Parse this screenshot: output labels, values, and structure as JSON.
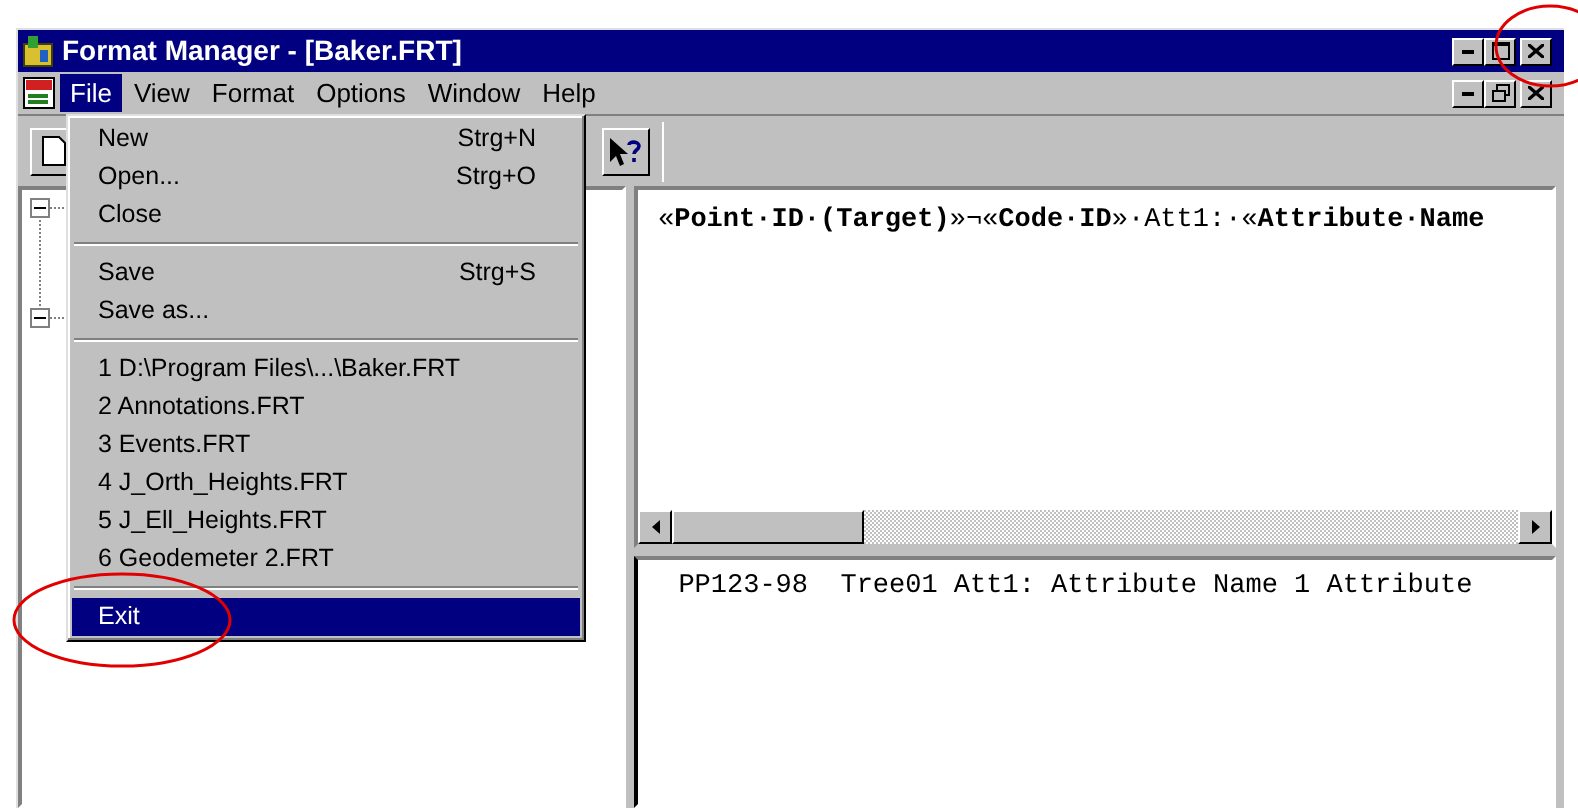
{
  "window": {
    "title": "Format Manager - [Baker.FRT]"
  },
  "menu_bar": [
    {
      "label": "File",
      "selected": true
    },
    {
      "label": "View",
      "selected": false
    },
    {
      "label": "Format",
      "selected": false
    },
    {
      "label": "Options",
      "selected": false
    },
    {
      "label": "Window",
      "selected": false
    },
    {
      "label": "Help",
      "selected": false
    }
  ],
  "file_menu": [
    {
      "kind": "item",
      "label": "New",
      "shortcut": "Strg+N",
      "selected": false
    },
    {
      "kind": "item",
      "label": "Open...",
      "shortcut": "Strg+O",
      "selected": false
    },
    {
      "kind": "item",
      "label": "Close",
      "selected": false
    },
    {
      "kind": "separator"
    },
    {
      "kind": "item",
      "label": "Save",
      "shortcut": "Strg+S",
      "selected": false
    },
    {
      "kind": "item",
      "label": "Save as...",
      "selected": false
    },
    {
      "kind": "separator"
    },
    {
      "kind": "item",
      "label": "1 D:\\Program Files\\...\\Baker.FRT",
      "selected": false
    },
    {
      "kind": "item",
      "label": "2 Annotations.FRT",
      "selected": false
    },
    {
      "kind": "item",
      "label": "3 Events.FRT",
      "selected": false
    },
    {
      "kind": "item",
      "label": "4 J_Orth_Heights.FRT",
      "selected": false
    },
    {
      "kind": "item",
      "label": "5 J_Ell_Heights.FRT",
      "selected": false
    },
    {
      "kind": "item",
      "label": "6 Geodemeter 2.FRT",
      "selected": false
    },
    {
      "kind": "separator"
    },
    {
      "kind": "item",
      "label": "Exit",
      "selected": true
    }
  ],
  "format_pane": {
    "text": "«**Point·ID·(Target)**»¬«**Code·ID**»·Att1:·«**Attribute·Name**"
  },
  "preview_pane": {
    "text": "  PP123-98  Tree01 Att1: Attribute Name 1 Attribute"
  }
}
